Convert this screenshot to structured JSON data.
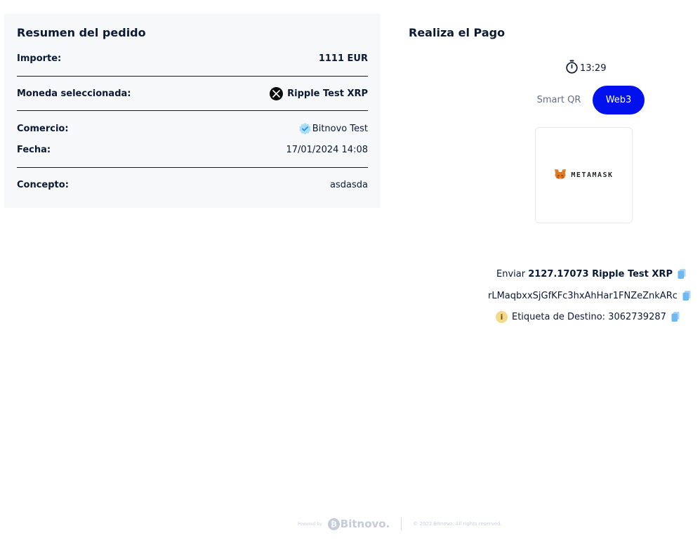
{
  "summary": {
    "title": "Resumen del pedido",
    "amount_label": "Importe:",
    "amount_value": "1111 EUR",
    "currency_label": "Moneda seleccionada:",
    "currency_value": "Ripple Test XRP",
    "currency_icon": "xrp-icon",
    "merchant_label": "Comercio:",
    "merchant_value": "Bitnovo Test",
    "merchant_icon": "verified-badge-icon",
    "date_label": "Fecha:",
    "date_value": "17/01/2024 14:08",
    "concept_label": "Concepto:",
    "concept_value": "asdasda"
  },
  "payment": {
    "title": "Realiza el Pago",
    "timer": "13:29",
    "tabs": [
      {
        "label": "Smart QR",
        "active": false
      },
      {
        "label": "Web3",
        "active": true
      }
    ],
    "wallet_name": "METAMASK",
    "send_prefix": "Enviar",
    "send_amount": "2127.17073 Ripple Test XRP",
    "address": "rLMaqbxxSjGfKFc3hxAhHar1FNZeZnkARc",
    "destination_tag": "Etiqueta de Destino: 3062739287"
  },
  "footer": {
    "powered_by": "Powered by",
    "brand": "Bitnovo.",
    "copyright": "© 2022 Bitnovo. All rights reserved."
  },
  "colors": {
    "accent": "#0011ee",
    "card_bg": "#f7f8fa",
    "text": "#0b1a34",
    "copy_icon": "#8fc9f7"
  }
}
